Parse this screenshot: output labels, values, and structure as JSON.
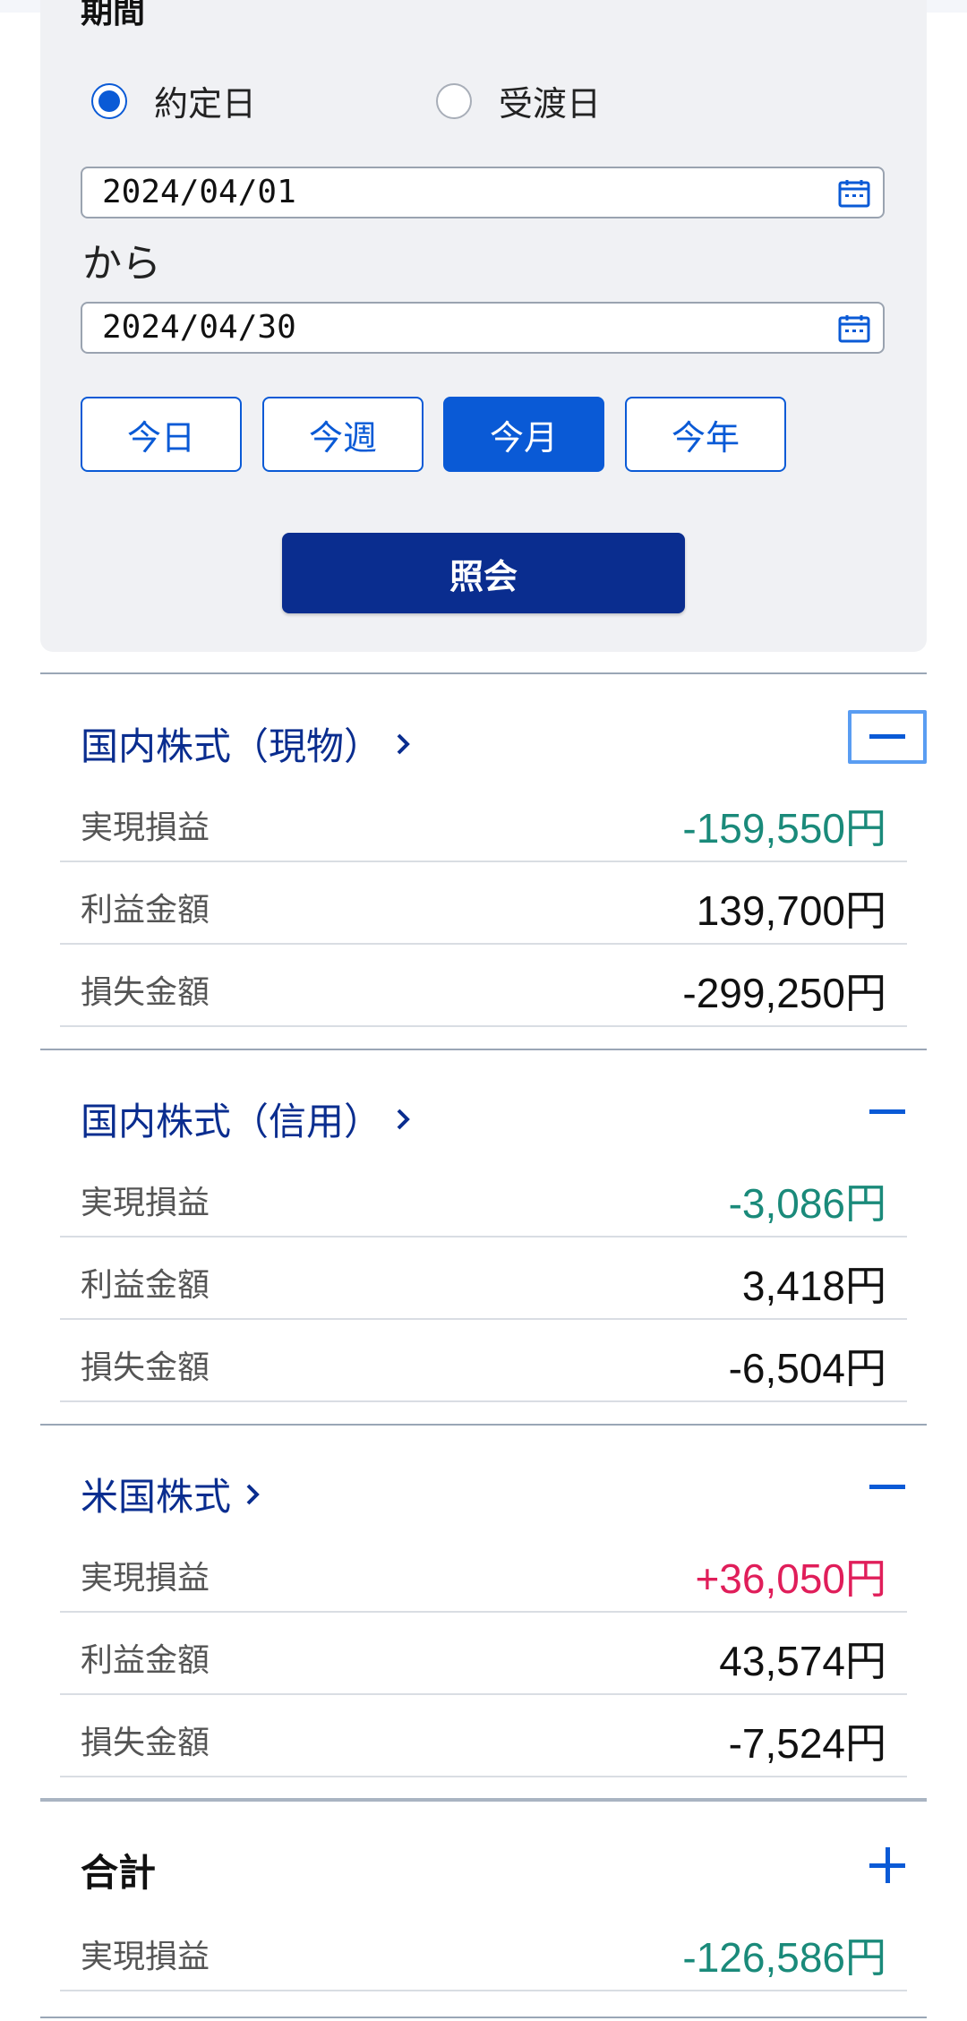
{
  "period": {
    "label": "期間",
    "radio_trade": "約定日",
    "radio_delivery": "受渡日",
    "start_date": "2024/04/01",
    "from_label": "から",
    "end_date": "2024/04/30",
    "quick_buttons": [
      "今日",
      "今週",
      "今月",
      "今年"
    ],
    "active_quick": "今月",
    "inquiry_label": "照会"
  },
  "sections": [
    {
      "title": "国内株式（現物）",
      "rows": [
        {
          "label": "実現損益",
          "value": "-159,550円"
        },
        {
          "label": "利益金額",
          "value": "139,700円"
        },
        {
          "label": "損失金額",
          "value": "-299,250円"
        }
      ]
    },
    {
      "title": "国内株式（信用）",
      "rows": [
        {
          "label": "実現損益",
          "value": "-3,086円"
        },
        {
          "label": "利益金額",
          "value": "3,418円"
        },
        {
          "label": "損失金額",
          "value": "-6,504円"
        }
      ]
    },
    {
      "title": "米国株式",
      "rows": [
        {
          "label": "実現損益",
          "value": "+36,050円"
        },
        {
          "label": "利益金額",
          "value": "43,574円"
        },
        {
          "label": "損失金額",
          "value": "-7,524円"
        }
      ]
    }
  ],
  "total": {
    "title": "合計",
    "rows": [
      {
        "label": "実現損益",
        "value": "-126,586円"
      }
    ]
  },
  "colors": {
    "accent": "#0a5ad6",
    "navy": "#0a2d8f",
    "loss_green": "#1a8a7a",
    "gain_red": "#e01e5a"
  },
  "icons": {
    "calendar": "calendar-icon",
    "chevron": "chevron-right-icon",
    "collapse": "minus-icon",
    "expand": "plus-icon"
  }
}
